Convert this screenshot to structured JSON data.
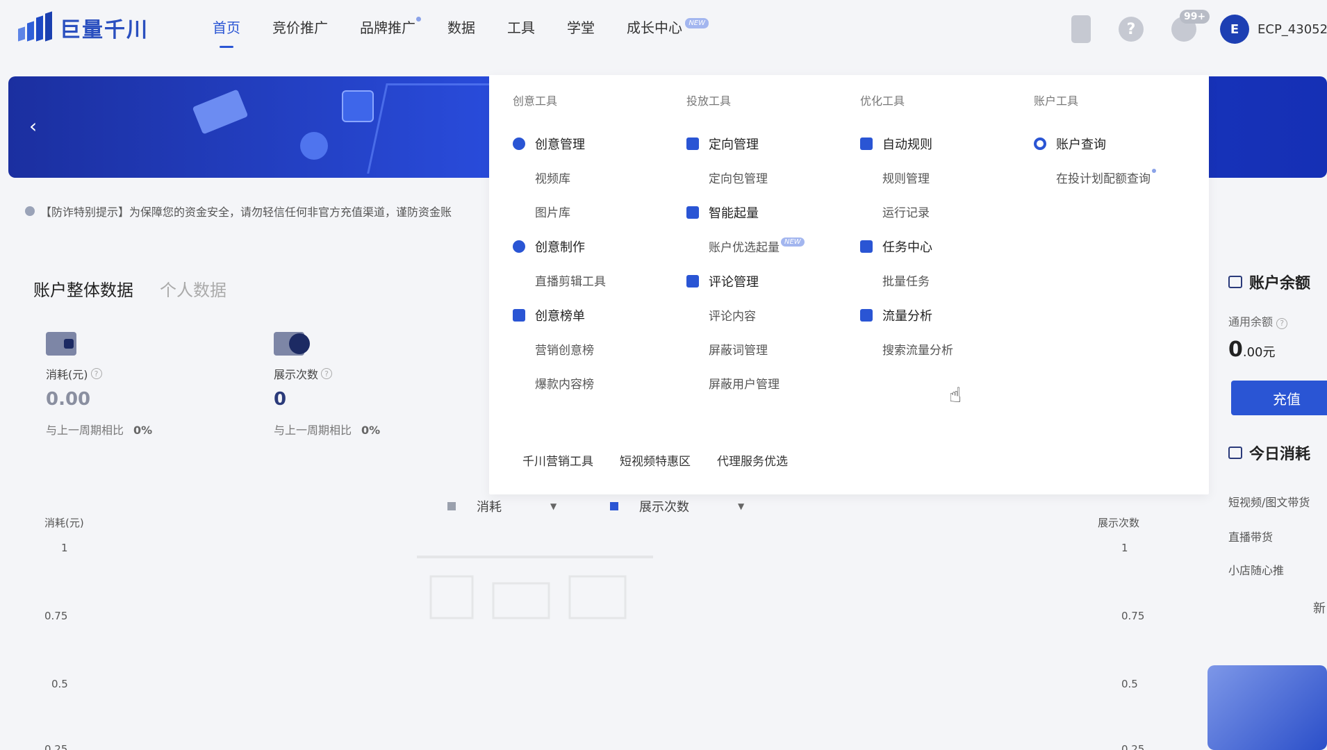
{
  "brand": {
    "name": "巨量千川"
  },
  "nav": {
    "items": [
      {
        "label": "首页",
        "active": true
      },
      {
        "label": "竞价推广"
      },
      {
        "label": "品牌推广",
        "dot": true
      },
      {
        "label": "数据"
      },
      {
        "label": "工具"
      },
      {
        "label": "学堂"
      },
      {
        "label": "成长中心",
        "badge": "NEW"
      }
    ],
    "messages_badge": "99+",
    "avatar_letter": "E",
    "account_name": "ECP_43052",
    "help_icon": "question-icon",
    "phone_icon": "phone-icon"
  },
  "banner": {
    "prev_icon": "‹"
  },
  "notice": {
    "text": "【防诈特别提示】为保障您的资金安全，请勿轻信任何非官方充值渠道，谨防资金账"
  },
  "data_tabs": [
    "账户整体数据",
    "个人数据"
  ],
  "stats": [
    {
      "label": "消耗(元)",
      "value": "0.00",
      "compare_label": "与上一周期相比",
      "compare_value": "0%"
    },
    {
      "label": "展示次数",
      "value": "0",
      "compare_label": "与上一周期相比",
      "compare_value": "0%"
    }
  ],
  "chart_data": {
    "type": "line",
    "legend": [
      {
        "name": "消耗",
        "color": "#9aa0ad"
      },
      {
        "name": "展示次数",
        "color": "#2a55d4"
      }
    ],
    "left_axis_title": "消耗(元)",
    "right_axis_title": "展示次数",
    "left_ticks": [
      "1",
      "0.75",
      "0.5",
      "0.25"
    ],
    "right_ticks": [
      "1",
      "0.75",
      "0.5",
      "0.25"
    ],
    "ylim": [
      0,
      1
    ],
    "series": []
  },
  "dropdown": {
    "columns": [
      {
        "title": "创意工具",
        "groups": [
          {
            "label": "创意管理",
            "icon": "bulb-icon",
            "items": [
              "视频库",
              "图片库"
            ]
          },
          {
            "label": "创意制作",
            "icon": "bulb-icon",
            "items": [
              "直播剪辑工具"
            ]
          },
          {
            "label": "创意榜单",
            "icon": "list-icon",
            "items": [
              "营销创意榜",
              "爆款内容榜"
            ]
          }
        ]
      },
      {
        "title": "投放工具",
        "groups": [
          {
            "label": "定向管理",
            "icon": "folder-user-icon",
            "items": [
              "定向包管理"
            ]
          },
          {
            "label": "智能起量",
            "icon": "chart-up-icon",
            "items": [
              "账户优选起量"
            ]
          },
          {
            "label": "评论管理",
            "icon": "comment-icon",
            "items": [
              "评论内容",
              "屏蔽词管理",
              "屏蔽用户管理"
            ]
          }
        ]
      },
      {
        "title": "优化工具",
        "groups": [
          {
            "label": "自动规则",
            "icon": "rule-icon",
            "items": [
              "规则管理",
              "运行记录"
            ]
          },
          {
            "label": "任务中心",
            "icon": "task-icon",
            "items": [
              "批量任务"
            ]
          },
          {
            "label": "流量分析",
            "icon": "analysis-icon",
            "items": [
              "搜索流量分析"
            ]
          }
        ]
      },
      {
        "title": "账户工具",
        "groups": [
          {
            "label": "账户查询",
            "icon": "ring-icon",
            "items": [
              "在投计划配额查询"
            ]
          }
        ]
      }
    ],
    "footer": [
      "千川营销工具",
      "短视频特惠区",
      "代理服务优选"
    ],
    "new_badge": "NEW"
  },
  "right_panel": {
    "balance_title": "账户余额",
    "avail_label": "通用余额",
    "balance_int": "0",
    "balance_dec": ".00",
    "balance_unit": "元",
    "recharge": "充值",
    "today_title": "今日消耗",
    "today_items": [
      "短视频/图文带货",
      "直播带货",
      "小店随心推"
    ],
    "more": "新"
  }
}
